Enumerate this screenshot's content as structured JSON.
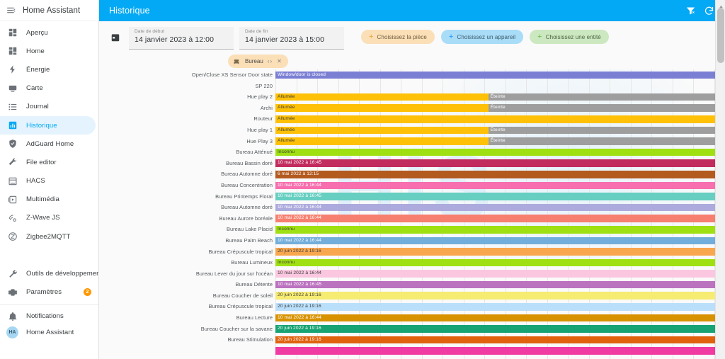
{
  "sidebar": {
    "brand": "Home Assistant",
    "menu_icon": "hamburger-menu-icon",
    "items": [
      {
        "label": "Aperçu",
        "icon": "view-dashboard-icon",
        "active": false
      },
      {
        "label": "Home",
        "icon": "view-dashboard-icon",
        "active": false
      },
      {
        "label": "Énergie",
        "icon": "lightning-bolt-icon",
        "active": false
      },
      {
        "label": "Carte",
        "icon": "map-icon",
        "active": false
      },
      {
        "label": "Journal",
        "icon": "format-list-icon",
        "active": false
      },
      {
        "label": "Historique",
        "icon": "chart-box-icon",
        "active": true
      },
      {
        "label": "AdGuard Home",
        "icon": "shield-icon",
        "active": false
      },
      {
        "label": "File editor",
        "icon": "wrench-icon",
        "active": false
      },
      {
        "label": "HACS",
        "icon": "store-icon",
        "active": false
      },
      {
        "label": "Multimédia",
        "icon": "play-box-icon",
        "active": false
      },
      {
        "label": "Z-Wave JS",
        "icon": "z-wave-icon",
        "active": false
      },
      {
        "label": "Zigbee2MQTT",
        "icon": "zigbee-icon",
        "active": false
      }
    ],
    "tools": [
      {
        "label": "Outils de développement",
        "icon": "hammer-wrench-icon",
        "badge": ""
      },
      {
        "label": "Paramètres",
        "icon": "gear-icon",
        "badge": "2"
      }
    ],
    "bottom": [
      {
        "label": "Notifications",
        "icon": "bell-icon",
        "badge": ""
      },
      {
        "label": "Home Assistant",
        "icon": "avatar",
        "initials": "HA"
      }
    ]
  },
  "header": {
    "title": "Historique",
    "filter_off_icon": "filter-off-icon",
    "refresh_icon": "refresh-icon",
    "accent_color": "#03a9f4"
  },
  "filters": {
    "calendar_icon": "calendar-icon",
    "start": {
      "label": "Date de début",
      "value": "14 janvier 2023 à 12:00"
    },
    "end": {
      "label": "Date de fin",
      "value": "14 janvier 2023 à 15:00"
    },
    "chips": [
      {
        "label": "Choisissez la pièce",
        "color": "#fbdfb7",
        "icon": "plus-icon"
      },
      {
        "label": "Choisissez un appareil",
        "color": "#a8dcf7",
        "icon": "plus-icon"
      },
      {
        "label": "Choisissez une entité",
        "color": "#cbe8c0",
        "icon": "plus-icon"
      }
    ],
    "selected": {
      "label": "Bureau",
      "icon": "sofa-icon",
      "expand_icon": "chevron-expand-icon",
      "close_icon": "close-icon",
      "color": "#fbdfb7"
    }
  },
  "watermark_text": "HIS",
  "chart_data": {
    "type": "timeline",
    "title": "Historique",
    "time_range": {
      "start": "14 janvier 2023 à 12:00",
      "end": "14 janvier 2023 à 15:00"
    },
    "gridline_count": 26,
    "gridline_spacing_px": 29.5,
    "rows": [
      {
        "label": "Open/Close XS Sensor Door state",
        "segments": [
          {
            "text": "Window/door is closed",
            "color": "#7b7fd4",
            "start_pct": 0,
            "width_pct": 100,
            "text_color": "light"
          }
        ]
      },
      {
        "label": "SP 220",
        "segments": []
      },
      {
        "label": "Hue play 2",
        "segments": [
          {
            "text": "Allumée",
            "color": "#ffc107",
            "start_pct": 0,
            "width_pct": 39.5,
            "text_color": "dark"
          },
          {
            "text": "Éteinte",
            "color": "#9e9e9e",
            "start_pct": 39.5,
            "width_pct": 60.5,
            "text_color": "light"
          }
        ]
      },
      {
        "label": "Archi",
        "segments": [
          {
            "text": "Allumée",
            "color": "#ffc107",
            "start_pct": 0,
            "width_pct": 39.5,
            "text_color": "dark"
          },
          {
            "text": "Éteinte",
            "color": "#9e9e9e",
            "start_pct": 39.5,
            "width_pct": 60.5,
            "text_color": "light"
          }
        ]
      },
      {
        "label": "Routeur",
        "segments": [
          {
            "text": "Allumée",
            "color": "#ffc107",
            "start_pct": 0,
            "width_pct": 100,
            "text_color": "dark"
          }
        ]
      },
      {
        "label": "Hue play 1",
        "segments": [
          {
            "text": "Allumée",
            "color": "#ffc107",
            "start_pct": 0,
            "width_pct": 39.5,
            "text_color": "dark"
          },
          {
            "text": "Éteinte",
            "color": "#9e9e9e",
            "start_pct": 39.5,
            "width_pct": 60.5,
            "text_color": "light"
          }
        ]
      },
      {
        "label": "Hue Play 3",
        "segments": [
          {
            "text": "Allumée",
            "color": "#ffc107",
            "start_pct": 0,
            "width_pct": 39.5,
            "text_color": "dark"
          },
          {
            "text": "Éteinte",
            "color": "#9e9e9e",
            "start_pct": 39.5,
            "width_pct": 60.5,
            "text_color": "light"
          }
        ]
      },
      {
        "label": "Bureau Atténué",
        "segments": [
          {
            "text": "Inconnu",
            "color": "#9fe012",
            "start_pct": 0,
            "width_pct": 100,
            "text_color": "dark"
          }
        ]
      },
      {
        "label": "Bureau Bassin doré",
        "segments": [
          {
            "text": "10 mai 2022 à 16:45",
            "color": "#c22b5e",
            "start_pct": 0,
            "width_pct": 100,
            "text_color": "light"
          }
        ]
      },
      {
        "label": "Bureau Automne doré",
        "segments": [
          {
            "text": "6 mai 2022 à 12:15",
            "color": "#b35a1f",
            "start_pct": 0,
            "width_pct": 100,
            "text_color": "light"
          }
        ]
      },
      {
        "label": "Bureau Concentration",
        "segments": [
          {
            "text": "10 mai 2022 à 16:44",
            "color": "#f76fae",
            "start_pct": 0,
            "width_pct": 100,
            "text_color": "light"
          }
        ]
      },
      {
        "label": "Bureau Printemps Floral",
        "segments": [
          {
            "text": "10 mai 2022 à 16:45",
            "color": "#66cfc1",
            "start_pct": 0,
            "width_pct": 100,
            "text_color": "light"
          }
        ]
      },
      {
        "label": "Bureau Automne doré",
        "segments": [
          {
            "text": "10 mai 2022 à 16:44",
            "color": "#adabdd",
            "start_pct": 0,
            "width_pct": 100,
            "text_color": "light"
          }
        ]
      },
      {
        "label": "Bureau Aurore boréale",
        "segments": [
          {
            "text": "10 mai 2022 à 16:44",
            "color": "#f77f6f",
            "start_pct": 0,
            "width_pct": 100,
            "text_color": "light"
          }
        ]
      },
      {
        "label": "Bureau Lake Placid",
        "segments": [
          {
            "text": "Inconnu",
            "color": "#9fe012",
            "start_pct": 0,
            "width_pct": 100,
            "text_color": "dark"
          }
        ]
      },
      {
        "label": "Bureau Palm Beach",
        "segments": [
          {
            "text": "10 mai 2022 à 16:44",
            "color": "#72aedb",
            "start_pct": 0,
            "width_pct": 100,
            "text_color": "light"
          }
        ]
      },
      {
        "label": "Bureau Crépuscule tropical",
        "segments": [
          {
            "text": "20 juin 2022 à 19:16",
            "color": "#f9a74f",
            "start_pct": 0,
            "width_pct": 100,
            "text_color": "dark"
          }
        ]
      },
      {
        "label": "Bureau Lumineux",
        "segments": [
          {
            "text": "Inconnu",
            "color": "#9fe012",
            "start_pct": 0,
            "width_pct": 100,
            "text_color": "dark"
          }
        ]
      },
      {
        "label": "Bureau Lever du jour sur l'océan",
        "segments": [
          {
            "text": "10 mai 2022 à 16:44",
            "color": "#fbc7e0",
            "start_pct": 0,
            "width_pct": 100,
            "text_color": "dark"
          }
        ]
      },
      {
        "label": "Bureau Détente",
        "segments": [
          {
            "text": "10 mai 2022 à 16:45",
            "color": "#bb72bf",
            "start_pct": 0,
            "width_pct": 100,
            "text_color": "light"
          }
        ]
      },
      {
        "label": "Bureau Coucher de soleil",
        "segments": [
          {
            "text": "20 juin 2022 à 19:16",
            "color": "#f7ec72",
            "start_pct": 0,
            "width_pct": 100,
            "text_color": "dark"
          }
        ]
      },
      {
        "label": "Bureau Crépuscule tropical",
        "segments": [
          {
            "text": "20 juin 2022 à 19:16",
            "color": "#badffb",
            "start_pct": 0,
            "width_pct": 100,
            "text_color": "dark"
          }
        ]
      },
      {
        "label": "Bureau Lecture",
        "segments": [
          {
            "text": "10 mai 2022 à 16:44",
            "color": "#d89200",
            "start_pct": 0,
            "width_pct": 100,
            "text_color": "light"
          }
        ]
      },
      {
        "label": "Bureau Coucher sur la savane",
        "segments": [
          {
            "text": "20 juin 2022 à 19:16",
            "color": "#17a373",
            "start_pct": 0,
            "width_pct": 100,
            "text_color": "light"
          }
        ]
      },
      {
        "label": "Bureau Stimulation",
        "segments": [
          {
            "text": "20 juin 2022 à 19:16",
            "color": "#e0620d",
            "start_pct": 0,
            "width_pct": 100,
            "text_color": "light"
          }
        ]
      },
      {
        "label": "",
        "segments": [
          {
            "text": "",
            "color": "#ef3ba2",
            "start_pct": 0,
            "width_pct": 100,
            "text_color": "light"
          }
        ]
      }
    ]
  },
  "scrollbar": {
    "name": "vertical-scrollbar",
    "thumb_top_pct": 2,
    "thumb_height_pct": 16
  }
}
